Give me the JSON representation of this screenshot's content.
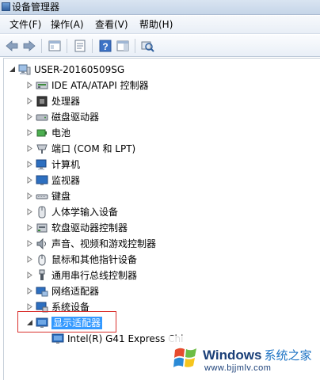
{
  "window": {
    "title": "设备管理器"
  },
  "menu": [
    "文件(F)",
    "操作(A)",
    "查看(V)",
    "帮助(H)"
  ],
  "toolbar": {
    "buttons": [
      "back-arrow-icon",
      "forward-arrow-icon",
      "show-hide-tree-icon",
      "properties-icon",
      "help-icon",
      "action-pane-icon",
      "scan-hardware-icon"
    ]
  },
  "tree": {
    "root": "USER-20160509SG",
    "items": [
      {
        "label": "IDE ATA/ATAPI 控制器",
        "icon": "ide-controller-icon"
      },
      {
        "label": "处理器",
        "icon": "processor-icon"
      },
      {
        "label": "磁盘驱动器",
        "icon": "disk-drive-icon"
      },
      {
        "label": "电池",
        "icon": "battery-icon"
      },
      {
        "label": "端口 (COM 和 LPT)",
        "icon": "port-icon"
      },
      {
        "label": "计算机",
        "icon": "computer-icon"
      },
      {
        "label": "监视器",
        "icon": "monitor-icon"
      },
      {
        "label": "键盘",
        "icon": "keyboard-icon"
      },
      {
        "label": "人体学输入设备",
        "icon": "hid-icon"
      },
      {
        "label": "软盘驱动器控制器",
        "icon": "floppy-controller-icon"
      },
      {
        "label": "声音、视频和游戏控制器",
        "icon": "sound-icon"
      },
      {
        "label": "鼠标和其他指针设备",
        "icon": "mouse-icon"
      },
      {
        "label": "通用串行总线控制器",
        "icon": "usb-icon"
      },
      {
        "label": "网络适配器",
        "icon": "network-adapter-icon"
      },
      {
        "label": "系统设备",
        "icon": "system-device-icon"
      }
    ],
    "expanded": {
      "label": "显示适配器",
      "icon": "display-adapter-icon"
    },
    "child": {
      "label": "Intel(R) G41 Express Chi",
      "icon": "display-adapter-icon"
    }
  },
  "watermark": {
    "brand": "Windows",
    "brand_cn": "系统之家",
    "url": "www.bjjmlv.com"
  },
  "colors": {
    "highlight_box": "#d9302c",
    "selection": "#3399ff"
  }
}
